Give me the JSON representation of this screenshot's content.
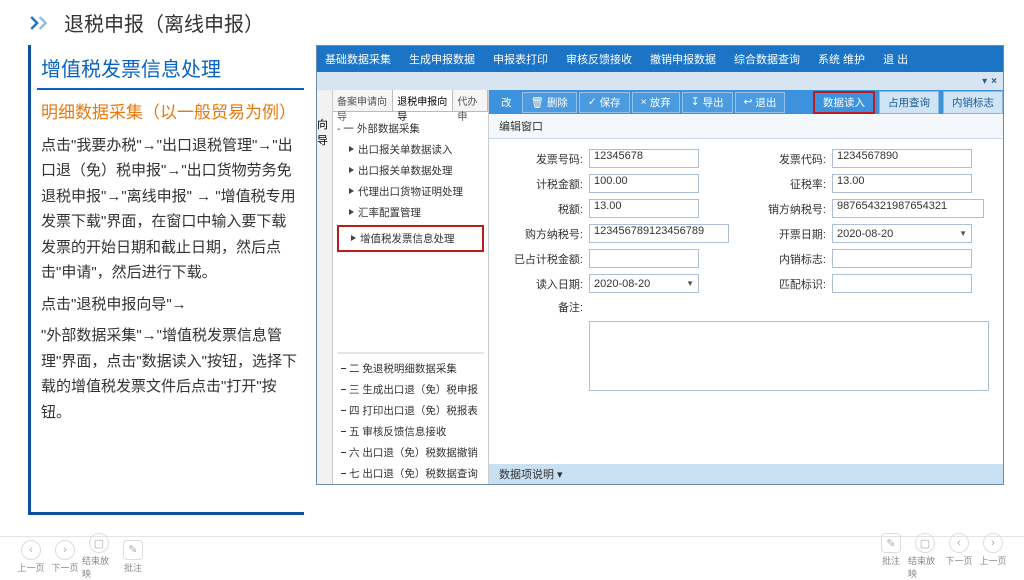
{
  "header": {
    "title": "退税申报（离线申报）"
  },
  "info": {
    "card_title": "增值税发票信息处理",
    "sub": "明细数据采集（以一般贸易为例）",
    "p1": "点击\"我要办税\"→\"出口退税管理\"→\"出口退（免）税申报\"→\"出口货物劳务免退税申报\"→\"离线申报\" → \"增值税专用发票下载\"界面，在窗口中输入要下载发票的开始日期和截止日期，然后点击\"申请\"，然后进行下载。",
    "p2": "点击\"退税申报向导\"→",
    "p3": "\"外部数据采集\"→\"增值税发票信息管理\"界面，点击\"数据读入\"按钮，选择下载的增值税发票文件后点击\"打开\"按钮。"
  },
  "menu": [
    "基础数据采集",
    "生成申报数据",
    "申报表打印",
    "审核反馈接收",
    "撤销申报数据",
    "综合数据查询",
    "系统 维护",
    "退 出"
  ],
  "side_handle": "向导",
  "tabs": [
    "备案申请向导",
    "退税申报向导",
    "代办申"
  ],
  "tree_parent": "一 外部数据采集",
  "tree_children": [
    "出口报关单数据读入",
    "出口报关单数据处理",
    "代理出口货物证明处理",
    "汇率配置管理",
    "增值税发票信息处理"
  ],
  "tree_numbered": [
    "二  免退税明细数据采集",
    "三  生成出口退（免）税申报",
    "四  打印出口退（免）税报表",
    "五  审核反馈信息接收",
    "六  出口退（免）税数据撤销",
    "七  出口退（免）税数据查询"
  ],
  "toolbar": {
    "left": [
      "改",
      "删除",
      "保存",
      "放弃",
      "导出",
      "退出"
    ],
    "hl": "数据读入",
    "extra": [
      "占用查询",
      "内销标志"
    ]
  },
  "subsection": "编辑窗口",
  "form": {
    "r1": {
      "l1": "发票号码:",
      "v1": "12345678",
      "l2": "发票代码:",
      "v2": "1234567890"
    },
    "r2": {
      "l1": "计税金额:",
      "v1": "100.00",
      "l2": "征税率:",
      "v2": "13.00"
    },
    "r3": {
      "l1": "税额:",
      "v1": "13.00",
      "l2": "销方纳税号:",
      "v2": "98765432198765432­1"
    },
    "r4": {
      "l1": "购方纳税号:",
      "v1": "123456789123456789",
      "l2": "开票日期:",
      "v2": "2020-08-20"
    },
    "r5": {
      "l1": "已占计税金额:",
      "v1": "",
      "l2": "内销标志:",
      "v2": ""
    },
    "r6": {
      "l1": "读入日期:",
      "v1": "2020-08-20",
      "l2": "匹配标识:",
      "v2": ""
    },
    "remark_label": "备注:"
  },
  "bottomrow": "数据项说明",
  "footer": {
    "left": [
      "上一页",
      "下一页",
      "结束放映",
      "批注"
    ],
    "right": [
      "批注",
      "结束放映",
      "下一页",
      "上一页"
    ]
  }
}
